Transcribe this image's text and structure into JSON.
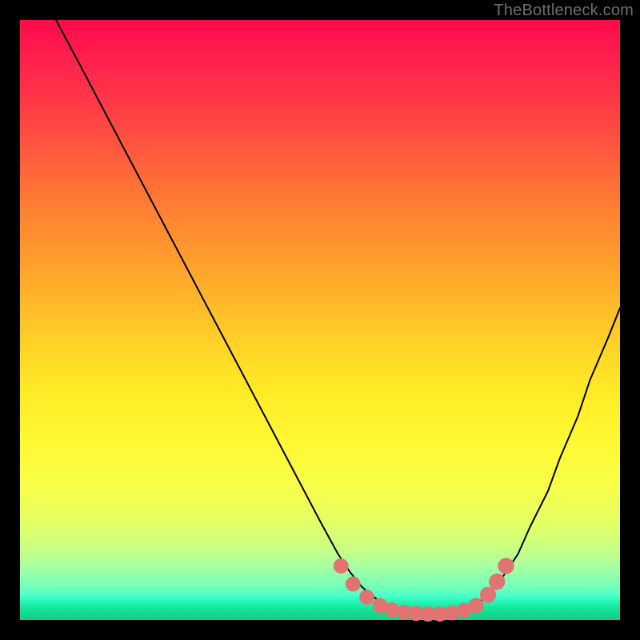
{
  "watermark": "TheBottleneck.com",
  "chart_data": {
    "type": "line",
    "title": "",
    "xlabel": "",
    "ylabel": "",
    "xlim": [
      0,
      100
    ],
    "ylim": [
      0,
      100
    ],
    "series": [
      {
        "name": "curve",
        "x": [
          6.0,
          10,
          15,
          20,
          25,
          30,
          35,
          40,
          45,
          50,
          53,
          55,
          57,
          60,
          63,
          65,
          68,
          70,
          73,
          75,
          78,
          80,
          83,
          85,
          88,
          90,
          93,
          95,
          98,
          100
        ],
        "y": [
          100,
          92.5,
          83,
          73.5,
          64,
          54.5,
          45,
          35.5,
          26,
          16.5,
          11,
          8,
          5.5,
          3,
          1.7,
          1.2,
          1.0,
          1.0,
          1.3,
          2.0,
          4,
          6.5,
          11,
          15.5,
          21.5,
          27,
          34,
          40,
          47,
          52
        ]
      }
    ],
    "markers": {
      "name": "dots",
      "color": "#e27373",
      "points": [
        {
          "x": 53.5,
          "y": 9.0,
          "r": 1.4
        },
        {
          "x": 55.5,
          "y": 6.0,
          "r": 1.4
        },
        {
          "x": 57.8,
          "y": 3.8,
          "r": 1.4
        },
        {
          "x": 60.0,
          "y": 2.4,
          "r": 1.4
        },
        {
          "x": 62.0,
          "y": 1.7,
          "r": 1.4
        },
        {
          "x": 64.0,
          "y": 1.3,
          "r": 1.4
        },
        {
          "x": 66.0,
          "y": 1.1,
          "r": 1.4
        },
        {
          "x": 68.0,
          "y": 1.0,
          "r": 1.4
        },
        {
          "x": 70.0,
          "y": 1.0,
          "r": 1.4
        },
        {
          "x": 72.0,
          "y": 1.2,
          "r": 1.4
        },
        {
          "x": 74.0,
          "y": 1.6,
          "r": 1.4
        },
        {
          "x": 76.0,
          "y": 2.4,
          "r": 1.4
        },
        {
          "x": 78.0,
          "y": 4.2,
          "r": 1.5
        },
        {
          "x": 79.5,
          "y": 6.4,
          "r": 1.5
        },
        {
          "x": 81.0,
          "y": 9.0,
          "r": 1.5
        }
      ]
    },
    "colors": {
      "curve_stroke": "#000000",
      "marker_fill": "#e27373"
    }
  }
}
